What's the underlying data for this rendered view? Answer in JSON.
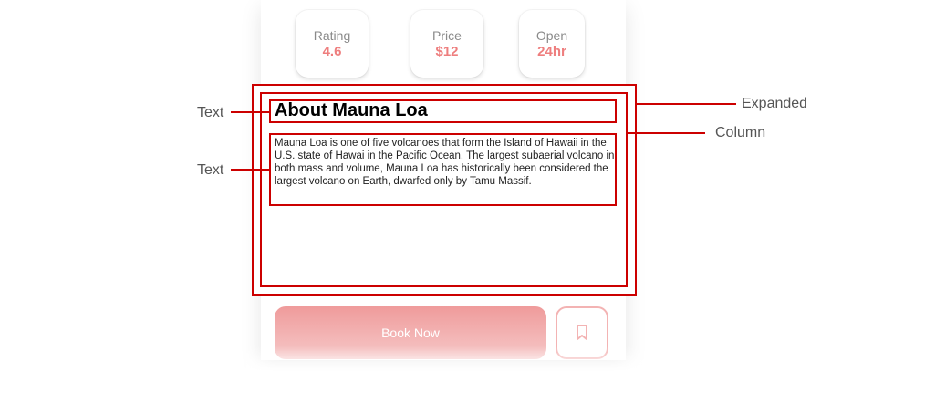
{
  "stats": [
    {
      "label": "Rating",
      "value": "4.6"
    },
    {
      "label": "Price",
      "value": "$12"
    },
    {
      "label": "Open",
      "value": "24hr"
    }
  ],
  "about": {
    "title": "About Mauna Loa",
    "description": "Mauna Loa is one of five volcanoes that form the Island of Hawaii in the U.S. state of Hawai in the Pacific Ocean. The largest subaerial volcano in both mass and volume, Mauna Loa has historically been considered the largest volcano on Earth, dwarfed only by Tamu Massif."
  },
  "actions": {
    "book_label": "Book Now",
    "bookmark_icon": "bookmark-icon"
  },
  "annotations": {
    "text_label_1": "Text",
    "text_label_2": "Text",
    "expanded_label": "Expanded",
    "column_label": "Column"
  },
  "colors": {
    "accent": "#ee7e7e",
    "annotation": "#cc0000"
  }
}
